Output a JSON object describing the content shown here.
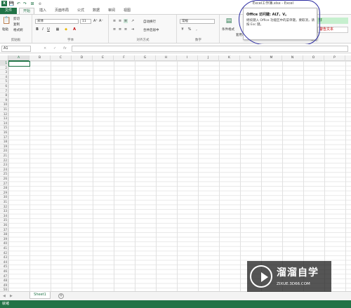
{
  "window": {
    "title": "Excel工作簿.xlsx - Excel"
  },
  "quick_access": {
    "app_icon": "X",
    "save_icon": "save-icon",
    "undo_icon": "undo-icon",
    "redo_icon": "redo-icon",
    "extra": "e"
  },
  "ribbon_tabs": [
    {
      "label": "文件"
    },
    {
      "label": "开始"
    },
    {
      "label": "插入"
    },
    {
      "label": "页面布局"
    },
    {
      "label": "公式"
    },
    {
      "label": "数据"
    },
    {
      "label": "审阅"
    },
    {
      "label": "视图"
    }
  ],
  "clipboard": {
    "paste": "粘贴",
    "cut": "剪切",
    "copy": "复制",
    "format_painter": "格式刷",
    "label": "剪贴板"
  },
  "font": {
    "name": "宋体",
    "size": "11",
    "bold": "B",
    "italic": "I",
    "underline": "U",
    "grow": "A⁺",
    "shrink": "A⁻",
    "label": "字体"
  },
  "alignment": {
    "wrap": "自动换行",
    "merge": "合并后居中",
    "label": "对齐方式"
  },
  "number": {
    "format": "常规",
    "currency": "%",
    "label": "数字"
  },
  "styles": {
    "conditional": "条件格式",
    "format_table": "套用表格格式",
    "good": "好",
    "warning": "警告文本",
    "label": "样式"
  },
  "tooltip": {
    "title": "Office 访问键: ALT，V。",
    "body": "继续键入 Office 功能区中的菜单键。要取消，请按 Esc 键。"
  },
  "formula_bar": {
    "name_box": "A1",
    "cancel": "×",
    "enter": "✓",
    "fx": "fx"
  },
  "columns": [
    "A",
    "B",
    "C",
    "D",
    "E",
    "F",
    "G",
    "H",
    "I",
    "J",
    "K",
    "L",
    "M",
    "N",
    "O",
    "P"
  ],
  "rows": [
    "1",
    "2",
    "3",
    "4",
    "5",
    "6",
    "7",
    "8",
    "9",
    "10",
    "11",
    "12",
    "13",
    "14",
    "15",
    "16",
    "17",
    "18",
    "19",
    "20",
    "21",
    "22",
    "23",
    "24",
    "25",
    "26",
    "27",
    "28",
    "29",
    "30",
    "31",
    "32",
    "33",
    "34",
    "35",
    "36",
    "37",
    "38",
    "39",
    "40",
    "41",
    "42",
    "43",
    "44",
    "45",
    "46",
    "47",
    "48",
    "49",
    "50"
  ],
  "sheets": [
    {
      "name": "Sheet1"
    }
  ],
  "add_sheet": "+",
  "status": {
    "text": "就绪"
  },
  "watermark": {
    "cn": "溜溜自学",
    "url": "ZIXUE.3D66.COM"
  },
  "colors": {
    "accent": "#217346",
    "warning": "#c00000",
    "good_fill": "#c6efce"
  }
}
